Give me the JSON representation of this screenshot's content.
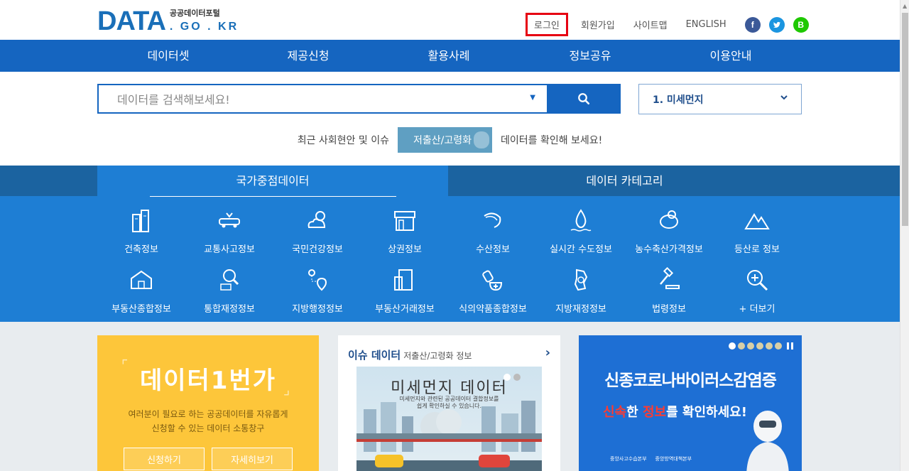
{
  "header": {
    "logo_main": "DATA",
    "logo_sub": "공공데이터포털",
    "logo_domain": ". GO . KR",
    "nav": [
      "로그인",
      "회원가입",
      "사이트맵",
      "ENGLISH"
    ],
    "sns": {
      "facebook": "f",
      "twitter": "t",
      "blog": "B"
    }
  },
  "mainmenu": [
    "데이터셋",
    "제공신청",
    "활용사례",
    "정보공유",
    "이용안내"
  ],
  "search": {
    "placeholder": "데이터를 검색해보세요!",
    "select_value": "1. 미세먼지"
  },
  "issue": {
    "before": "최근 사회현안 및 이슈",
    "button": "저출산/고령화",
    "after": "데이터를 확인해 보세요!"
  },
  "tabs": {
    "active": "국가중점데이터",
    "other": "데이터 카테고리"
  },
  "icons_row1": [
    "건축정보",
    "교통사고정보",
    "국민건강정보",
    "상권정보",
    "수산정보",
    "실시간 수도정보",
    "농수축산가격정보",
    "등산로 정보"
  ],
  "icons_row2": [
    "부동산종합정보",
    "통합재정정보",
    "지방행정정보",
    "부동산거래정보",
    "식의약품종합정보",
    "지방재정정보",
    "법령정보",
    "+ 더보기"
  ],
  "card1": {
    "title": "데이터1번가",
    "desc_line1": "여러분이 필요로 하는 공공데이터를 자유롭게",
    "desc_line2": "신청할 수 있는 데이터 소통창구",
    "btn1": "신청하기",
    "btn2": "자세히보기"
  },
  "card2": {
    "header": "이슈 데이터",
    "header_sub": "저출산/고령화 정보",
    "img_title": "미세먼지 데이터",
    "img_desc1": "미세먼지와 관련된 공공데이터 결합정보를",
    "img_desc2": "쉽게 확인하실 수 있습니다."
  },
  "card3": {
    "title": "신종코로나바이러스감염증",
    "line2_a": "신속",
    "line2_b": "한 ",
    "line2_c": "정보",
    "line2_d": "를 확인하세요!",
    "org1": "중앙사고수습본부",
    "org2": "중앙방역대책본부"
  },
  "colors": {
    "primary": "#1565c0",
    "login_highlight": "#e60012",
    "card1_bg": "#fdc63a",
    "card3_bg": "#1e6fd4"
  }
}
